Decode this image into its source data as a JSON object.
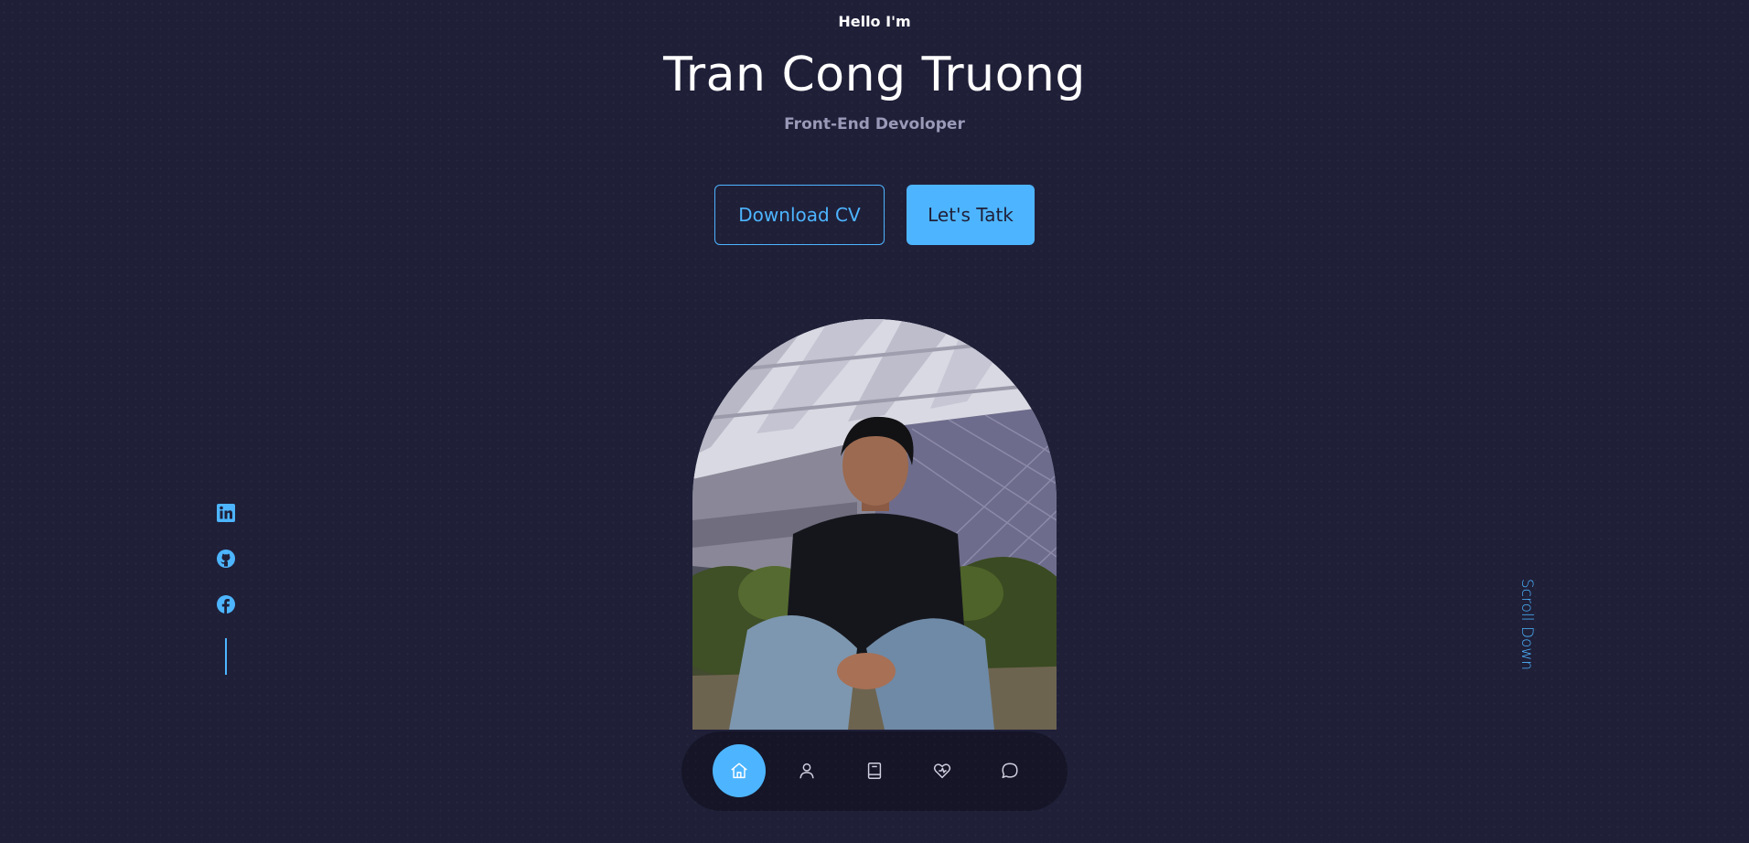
{
  "header": {
    "greeting": "Hello I'm",
    "name": "Tran Cong Truong",
    "role": "Front-End Devoloper"
  },
  "cta": {
    "download_cv": "Download CV",
    "lets_talk": "Let's Tatk"
  },
  "socials": [
    {
      "icon": "linkedin-icon"
    },
    {
      "icon": "github-icon"
    },
    {
      "icon": "facebook-icon"
    }
  ],
  "scroll": {
    "label": "Scroll Down"
  },
  "nav": {
    "items": [
      {
        "icon": "home-icon",
        "active": true
      },
      {
        "icon": "user-icon",
        "active": false
      },
      {
        "icon": "book-icon",
        "active": false
      },
      {
        "icon": "services-icon",
        "active": false
      },
      {
        "icon": "message-icon",
        "active": false
      }
    ]
  },
  "colors": {
    "background": "#1f1f38",
    "accent": "#4db5ff",
    "text": "#ffffff",
    "muted": "#9a9ab8"
  }
}
